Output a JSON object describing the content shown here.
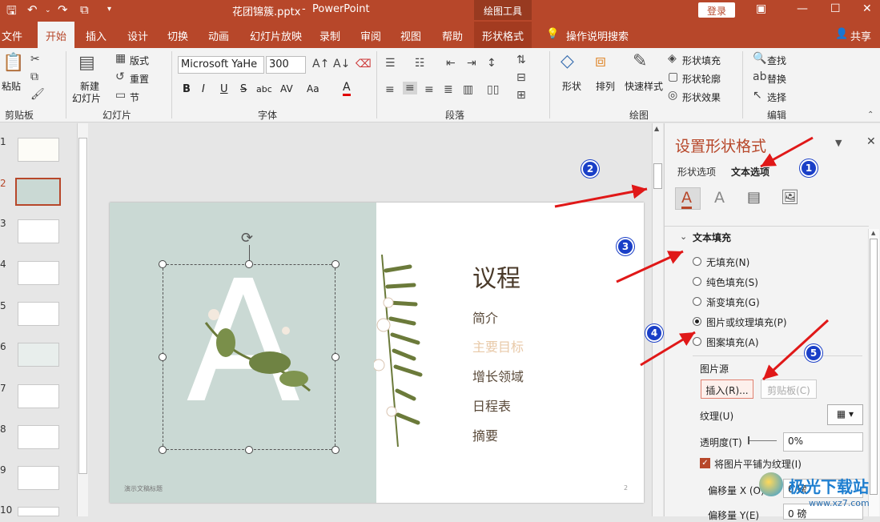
{
  "title": {
    "file": "花团锦簇.pptx",
    "sep": "-",
    "app": "PowerPoint",
    "context_tools": "绘图工具",
    "login": "登录"
  },
  "tabs": [
    "文件",
    "开始",
    "插入",
    "设计",
    "切换",
    "动画",
    "幻灯片放映",
    "录制",
    "审阅",
    "视图",
    "帮助",
    "形状格式"
  ],
  "tell_me": "操作说明搜索",
  "share": "共享",
  "ribbon": {
    "clipboard": {
      "paste": "粘贴",
      "group": "剪贴板"
    },
    "slides": {
      "new_slide": "新建",
      "new_slide2": "幻灯片",
      "layout": "版式",
      "reset": "重置",
      "section": "节",
      "group": "幻灯片"
    },
    "font": {
      "font_name": "Microsoft YaHe",
      "font_size": "300",
      "group": "字体",
      "bold": "B",
      "italic": "I",
      "underline": "U",
      "strike": "S",
      "shadow": "abc",
      "spacing": "AV",
      "case": "Aa",
      "color": "A"
    },
    "paragraph": {
      "group": "段落"
    },
    "drawing": {
      "shape": "形状",
      "arrange": "排列",
      "quick_style": "快速样式",
      "fill": "形状填充",
      "outline": "形状轮廓",
      "effect": "形状效果",
      "group": "绘图"
    },
    "editing": {
      "find": "查找",
      "replace": "替换",
      "select": "选择",
      "group": "编辑"
    }
  },
  "thumbs": {
    "numbers": [
      "1",
      "2",
      "3",
      "4",
      "5",
      "6",
      "7",
      "8",
      "9",
      "10"
    ],
    "selected": 2
  },
  "slide": {
    "big_letter": "A",
    "agenda_title": "议程",
    "items": [
      "简介",
      "主要目标",
      "增长领域",
      "日程表",
      "摘要"
    ],
    "footer": "演示文稿标题",
    "page": "2"
  },
  "panel": {
    "title": "设置形状格式",
    "tab_shape": "形状选项",
    "tab_text": "文本选项",
    "section": "文本填充",
    "options": [
      "无填充(N)",
      "纯色填充(S)",
      "渐变填充(G)",
      "图片或纹理填充(P)",
      "图案填充(A)"
    ],
    "selected_option": 3,
    "picture_source": "图片源",
    "insert_btn": "插入(R)...",
    "clipboard_btn": "剪贴板(C)",
    "texture_label": "纹理(U)",
    "transparency_label": "透明度(T)",
    "transparency_value": "0%",
    "tile_label": "将图片平铺为纹理(I)",
    "tile_checked": true,
    "offset_x_label": "偏移量 X (O)",
    "offset_x_value": "0 磅",
    "offset_y_label": "偏移量 Y(E)",
    "offset_y_value": "0 磅"
  },
  "markers": [
    "1",
    "2",
    "3",
    "4",
    "5"
  ],
  "watermark": {
    "text": "极光下载站",
    "url": "www.xz7.com"
  },
  "colors": {
    "brand": "#b7472a",
    "marker": "#1a3fc7",
    "arrow": "#e01818",
    "slide_left": "#cad9d4"
  }
}
